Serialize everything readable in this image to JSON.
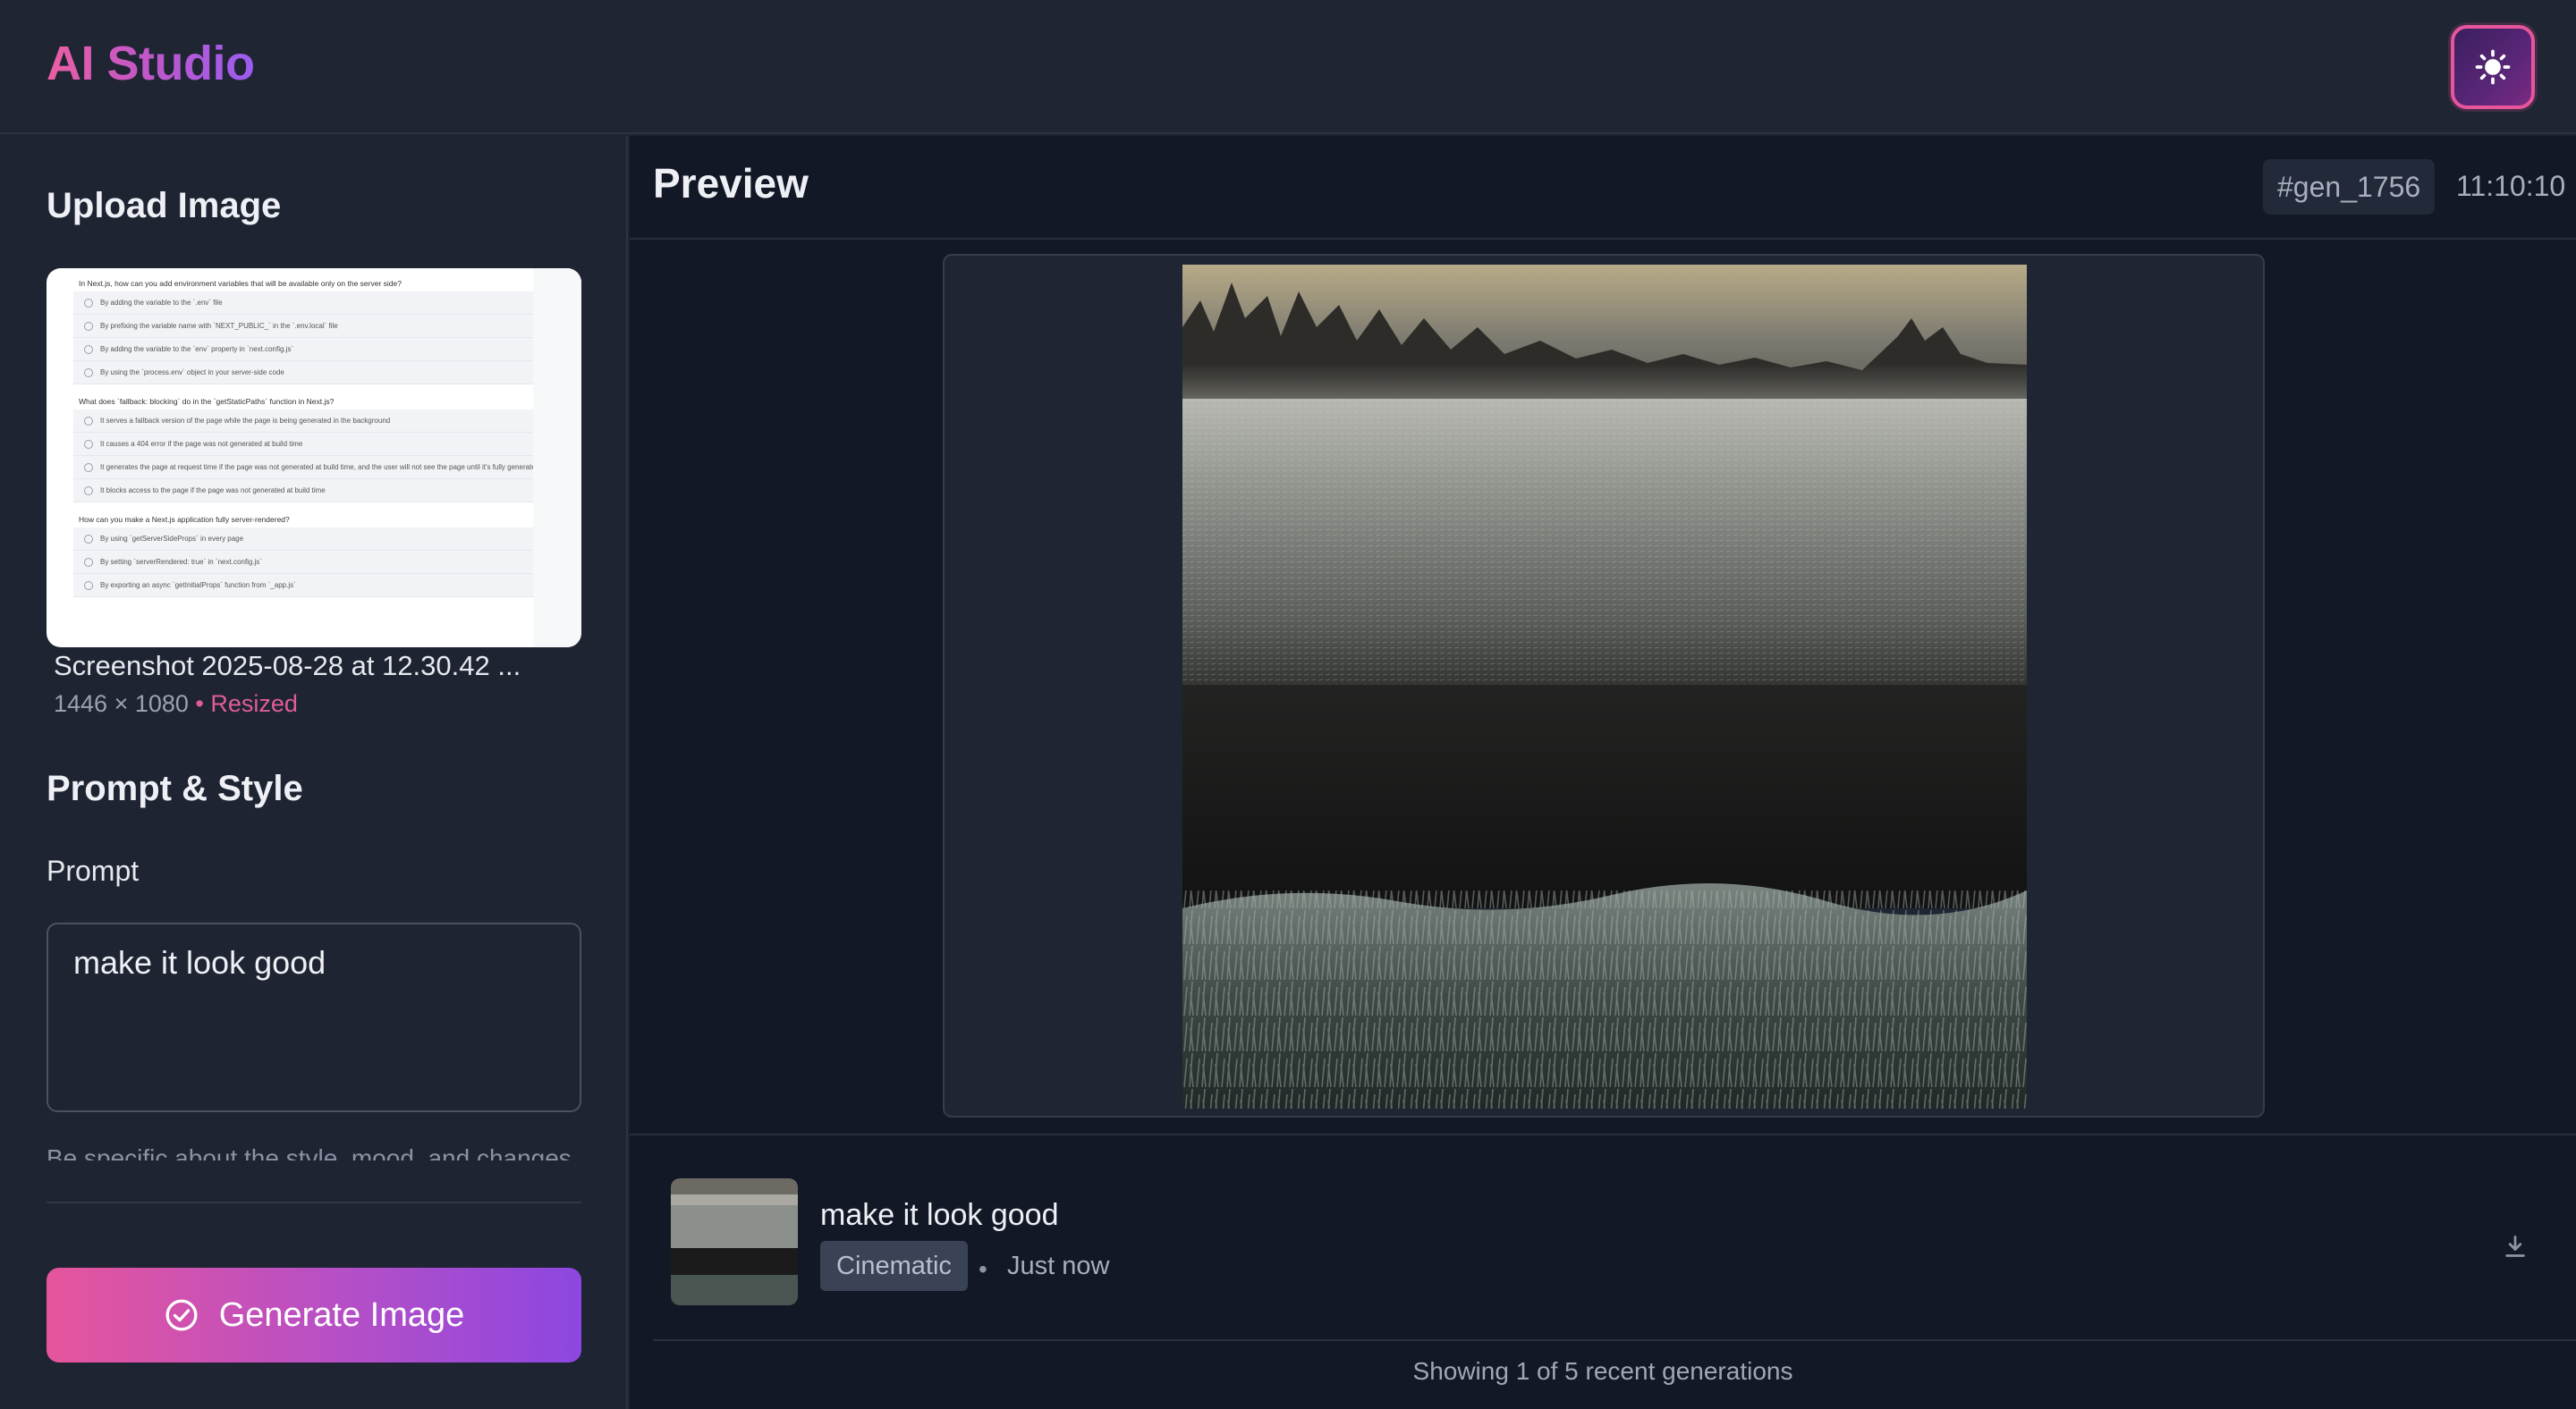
{
  "app": {
    "title": "AI Studio"
  },
  "header": {
    "theme_toggle_icon": "sun-icon"
  },
  "upload": {
    "heading": "Upload Image",
    "file_name": "Screenshot 2025-08-28 at 12.30.42 ...",
    "dimensions": "1446 × 1080",
    "separator": " • ",
    "status": "Resized",
    "thumbnail": {
      "groups": [
        {
          "question": "In Next.js, how can you add environment variables that will be available only on the server side?",
          "options": [
            "By adding the variable to the `.env` file",
            "By prefixing the variable name with `NEXT_PUBLIC_` in the `.env.local` file",
            "By adding the variable to the `env` property in `next.config.js`",
            "By using the `process.env` object in your server-side code"
          ]
        },
        {
          "question": "What does `fallback: blocking` do in the `getStaticPaths` function in Next.js?",
          "options": [
            "It serves a fallback version of the page while the page is being generated in the background",
            "It causes a 404 error if the page was not generated at build time",
            "It generates the page at request time if the page was not generated at build time, and the user will not see the page until it's fully generated",
            "It blocks access to the page if the page was not generated at build time"
          ]
        },
        {
          "question": "How can you make a Next.js application fully server-rendered?",
          "options": [
            "By using `getServerSideProps` in every page",
            "By setting `serverRendered: true` in `next.config.js`",
            "By exporting an async `getInitialProps` function from `_app.js`"
          ]
        }
      ]
    }
  },
  "prompt_style": {
    "heading": "Prompt & Style",
    "prompt_label": "Prompt",
    "prompt_value": "make it look good",
    "helper_text": "Be specific about the style, mood, and changes"
  },
  "generate": {
    "label": "Generate Image",
    "icon": "check-circle-icon"
  },
  "preview": {
    "title": "Preview",
    "generation_id": "#gen_1756",
    "time": "11:10:10"
  },
  "history": {
    "items": [
      {
        "prompt": "make it look good",
        "style": "Cinematic",
        "dot": "•",
        "when": "Just now",
        "action_icon": "download-icon"
      }
    ],
    "footer": "Showing 1 of 5 recent generations"
  }
}
